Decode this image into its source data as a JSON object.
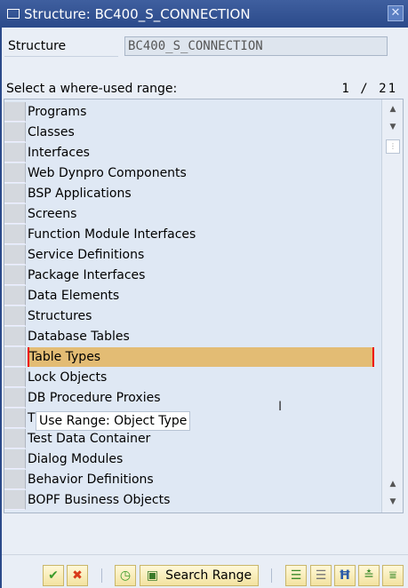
{
  "title": "Structure: BC400_S_CONNECTION",
  "structure_label": "Structure",
  "structure_value": "BC400_S_CONNECTION",
  "select_label": "Select a where-used range:",
  "page_counter": "1 / 21",
  "items": [
    "Programs",
    "Classes",
    "Interfaces",
    "Web Dynpro Components",
    "BSP Applications",
    "Screens",
    "Function Module Interfaces",
    "Service Definitions",
    "Package Interfaces",
    "Data Elements",
    "Structures",
    "Database Tables",
    "Table Types",
    "Lock Objects",
    "DB Procedure Proxies",
    "T",
    "Test Data Container",
    "Dialog Modules",
    "Behavior Definitions",
    "BOPF Business Objects"
  ],
  "selected_index": 12,
  "tooltip": "Use Range: Object Type",
  "toolbar": {
    "search_range": "Search Range"
  }
}
